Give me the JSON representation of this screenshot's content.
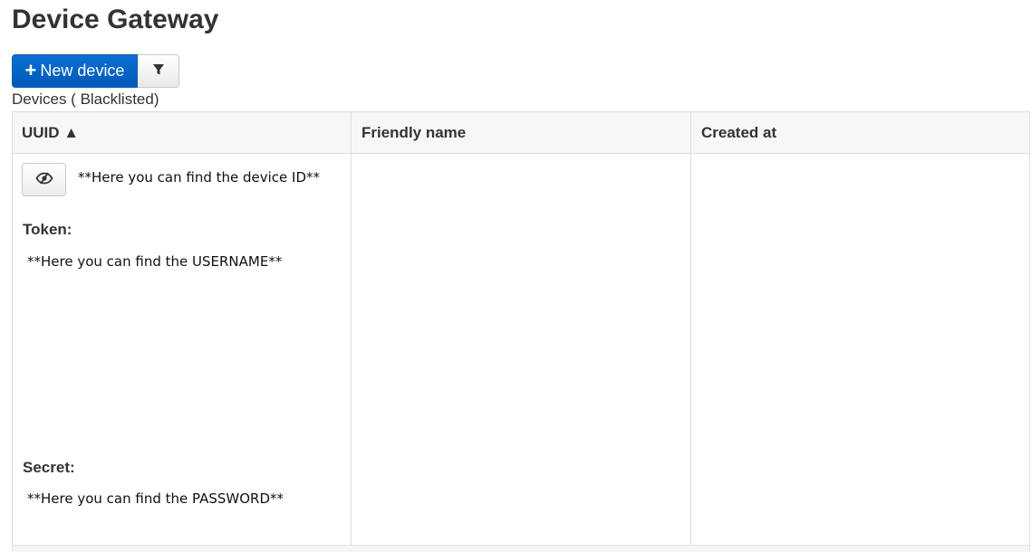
{
  "page": {
    "title": "Device Gateway"
  },
  "toolbar": {
    "new_device_label": "New device",
    "new_device_icon": "plus-icon",
    "filter_icon": "filter-icon"
  },
  "table": {
    "caption": "Devices ( Blacklisted)",
    "columns": [
      {
        "label": "UUID ▲",
        "sorted": "ascending"
      },
      {
        "label": "Friendly name"
      },
      {
        "label": "Created at"
      }
    ],
    "rows": [
      {
        "toggle_icon": "eye-slash-icon",
        "device_id": "**Here you can find the device ID**",
        "token_label": "Token:",
        "token_value": "**Here you can find the USERNAME**",
        "secret_label": "Secret:",
        "secret_value": "**Here you can find the PASSWORD**",
        "friendly_name": "",
        "created_at": ""
      }
    ]
  },
  "colors": {
    "primary": "#0059b8",
    "header_bg": "#f7f7f7",
    "border": "#dddddd"
  }
}
